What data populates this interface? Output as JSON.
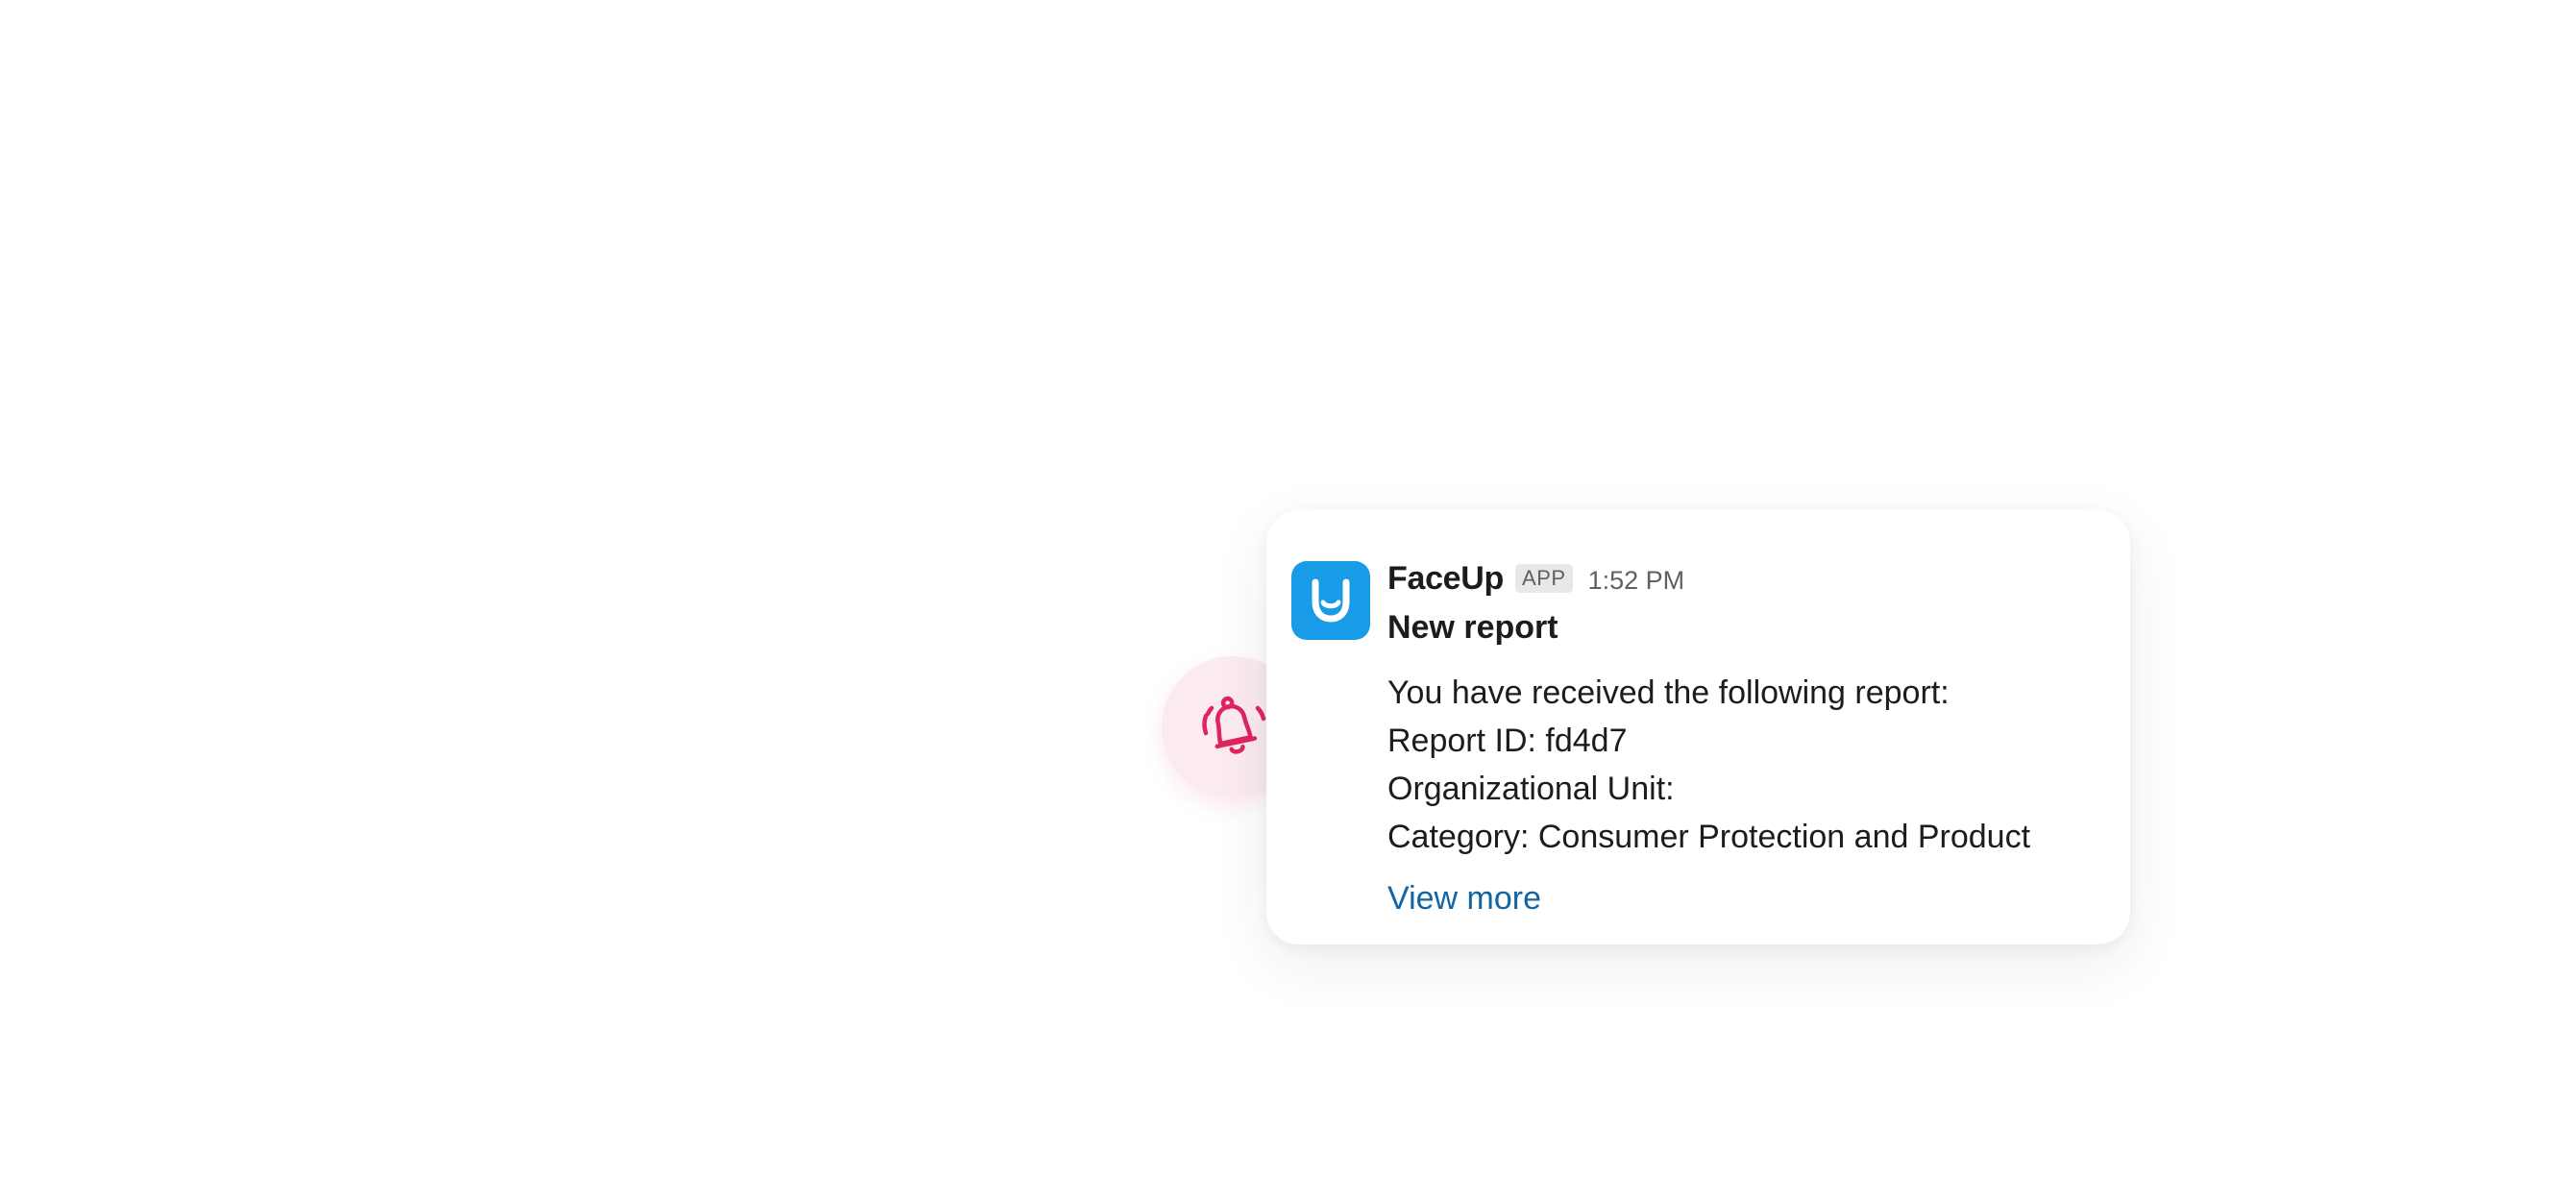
{
  "notification": {
    "app_name": "FaceUp",
    "app_tag": "APP",
    "timestamp": "1:52 PM",
    "title": "New report",
    "lines": [
      "You have received the following report:",
      "Report ID: fd4d7",
      "Organizational Unit:",
      "Category: Consumer Protection and Product"
    ],
    "link_label": "View more"
  },
  "colors": {
    "avatar_bg": "#1a9be8",
    "bell_accent": "#e0245e",
    "bell_badge_bg": "#fbeaf0",
    "link": "#1264a3"
  },
  "icons": {
    "avatar": "faceup-logo-icon",
    "badge": "bell-ringing-icon"
  }
}
